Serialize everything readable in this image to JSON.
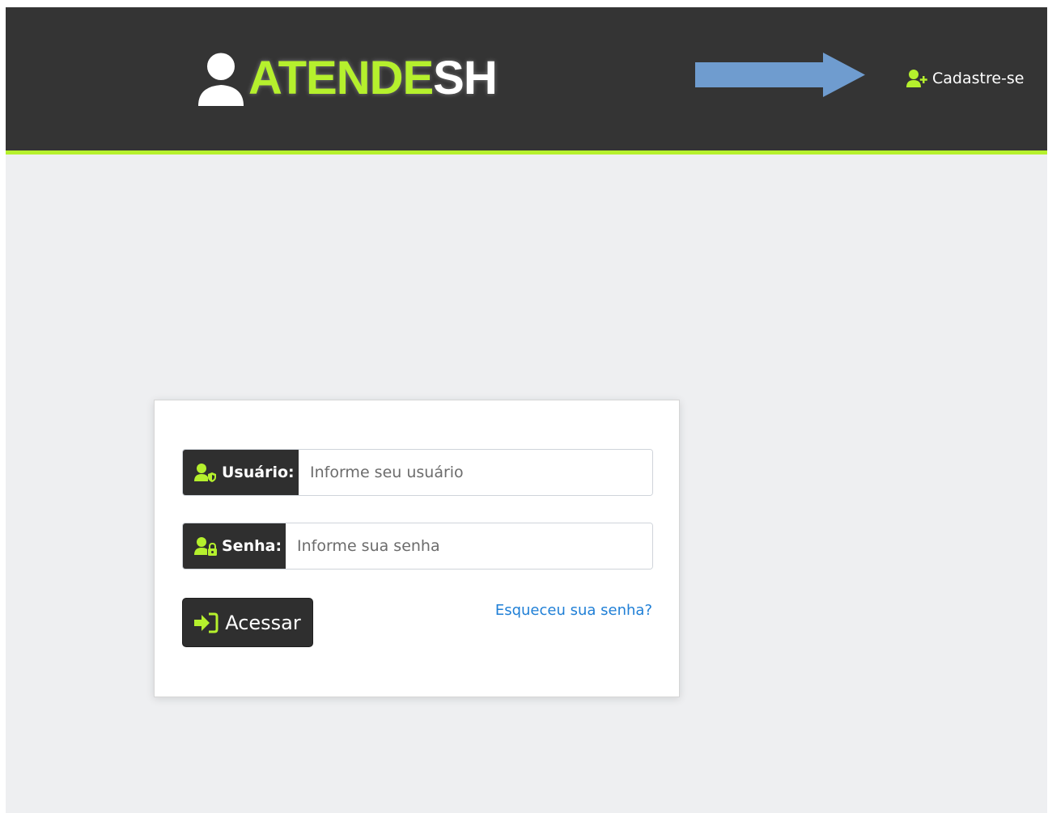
{
  "header": {
    "brand_part_green": "ATENDE",
    "brand_part_white": "SH",
    "signup_label": "Cadastre-se",
    "icons": [
      "headset-user-icon",
      "arrow-right-icon",
      "user-plus-icon"
    ]
  },
  "login": {
    "username_label": "Usuário:",
    "username_placeholder": "Informe seu usuário",
    "username_value": "",
    "password_label": "Senha:",
    "password_placeholder": "Informe sua senha",
    "password_value": "",
    "submit_label": "Acessar",
    "forgot_link": "Esqueceu sua senha?",
    "icons": [
      "user-shield-icon",
      "user-lock-icon",
      "sign-in-icon"
    ]
  },
  "colors": {
    "navbar_bg": "#343434",
    "accent_green": "#b5f02d",
    "page_bg": "#eeeff1",
    "arrow_blue": "#6f9ccf",
    "link_blue": "#1f7fd6",
    "dark_button": "#2f2f2f"
  }
}
